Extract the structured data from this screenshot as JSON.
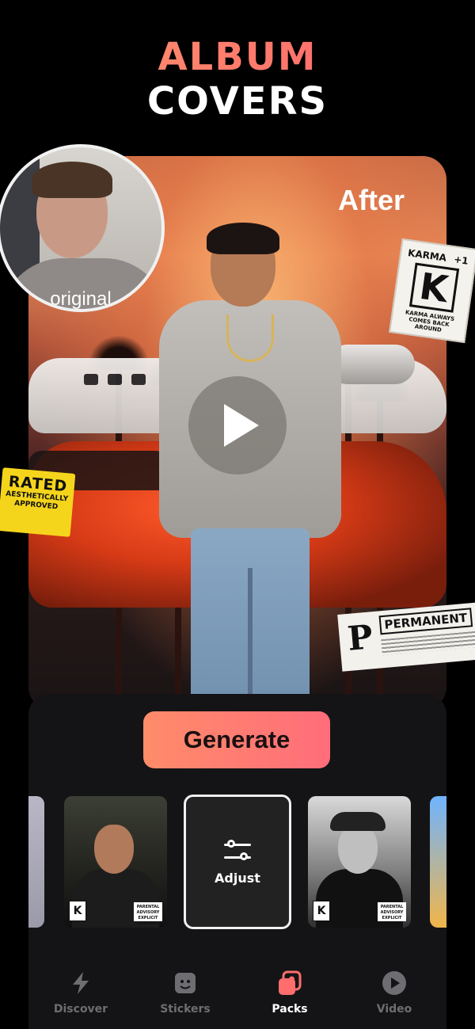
{
  "headline": {
    "line1": "ALBUM",
    "line2": "COVERS"
  },
  "preview": {
    "after_label": "After",
    "original_label": "original"
  },
  "stickers": {
    "karma": {
      "title": "KARMA",
      "plus": "+1",
      "letter": "K",
      "caption": "KARMA ALWAYS COMES BACK AROUND"
    },
    "rated": {
      "big": "RATED",
      "line1": "AESTHETICALLY",
      "line2": "APPROVED"
    },
    "permanent": {
      "letter": "P",
      "word": "PERMANENT"
    }
  },
  "generate_label": "Generate",
  "thumbnails": {
    "adjust_label": "Adjust",
    "advisory_text": "PARENTAL ADVISORY EXPLICIT CONTENT",
    "badge_letter": "K"
  },
  "nav": {
    "items": [
      {
        "label": "Discover",
        "icon": "bolt-icon"
      },
      {
        "label": "Stickers",
        "icon": "sticker-icon"
      },
      {
        "label": "Packs",
        "icon": "packs-icon"
      },
      {
        "label": "Video",
        "icon": "play-circle-icon"
      }
    ],
    "active": "Packs"
  },
  "colors": {
    "accent_start": "#ff8c6a",
    "accent_end": "#ff6d7a",
    "active_icon": "#ff6d6d",
    "inactive": "#6d6d72"
  }
}
